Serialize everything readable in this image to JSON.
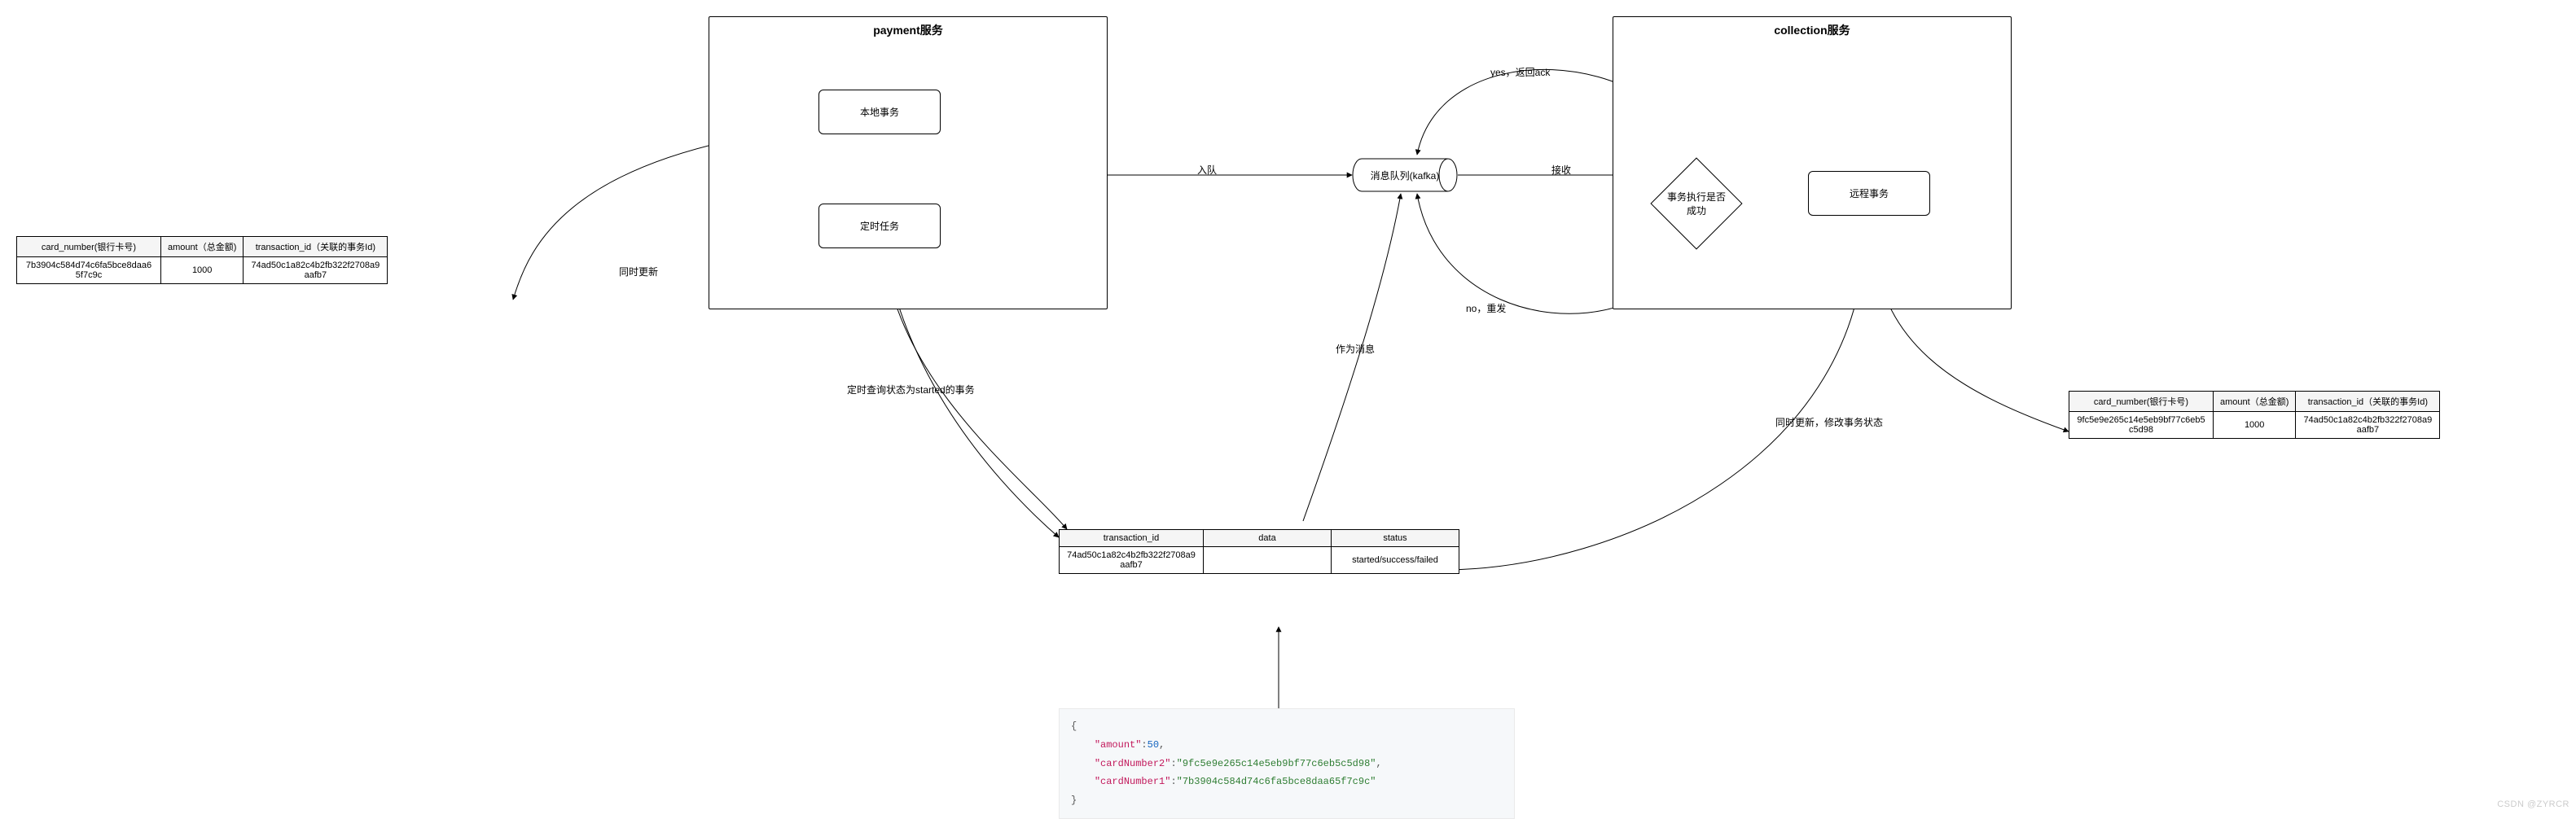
{
  "groups": {
    "payment": {
      "title": "payment服务"
    },
    "collection": {
      "title": "collection服务"
    }
  },
  "nodes": {
    "local_tx": "本地事务",
    "timed_task": "定时任务",
    "mq": "消息队列(kafka)",
    "remote_tx": "远程事务",
    "decision": "事务执行是否成功"
  },
  "edges": {
    "enqueue": "入队",
    "receive": "接收",
    "yes_ack": "yes，返回ack",
    "no_resend": "no，重发",
    "poll_started": "定时查询状态为started的事务",
    "as_message": "作为消息",
    "update_left": "同时更新",
    "update_right": "同时更新，修改事务状态"
  },
  "table_left": {
    "headers": [
      "card_number(银行卡号)",
      "amount（总金额)",
      "transaction_id（关联的事务Id)"
    ],
    "row": [
      "7b3904c584d74c6fa5bce8daa65f7c9c",
      "1000",
      "74ad50c1a82c4b2fb322f2708a9aafb7"
    ]
  },
  "table_right": {
    "headers": [
      "card_number(银行卡号)",
      "amount（总金额)",
      "transaction_id（关联的事务Id)"
    ],
    "row": [
      "9fc5e9e265c14e5eb9bf77c6eb5c5d98",
      "1000",
      "74ad50c1a82c4b2fb322f2708a9aafb7"
    ]
  },
  "table_center": {
    "headers": [
      "transaction_id",
      "data",
      "status"
    ],
    "row": [
      "74ad50c1a82c4b2fb322f2708a9aafb7",
      "",
      "started/success/failed"
    ]
  },
  "code": {
    "open": "{",
    "k_amount": "\"amount\"",
    "v_amount": "50",
    "k_card2": "\"cardNumber2\"",
    "v_card2": "\"9fc5e9e265c14e5eb9bf77c6eb5c5d98\"",
    "k_card1": "\"cardNumber1\"",
    "v_card1": "\"7b3904c584d74c6fa5bce8daa65f7c9c\"",
    "close": "}"
  },
  "watermark": "CSDN @ZYRCR"
}
